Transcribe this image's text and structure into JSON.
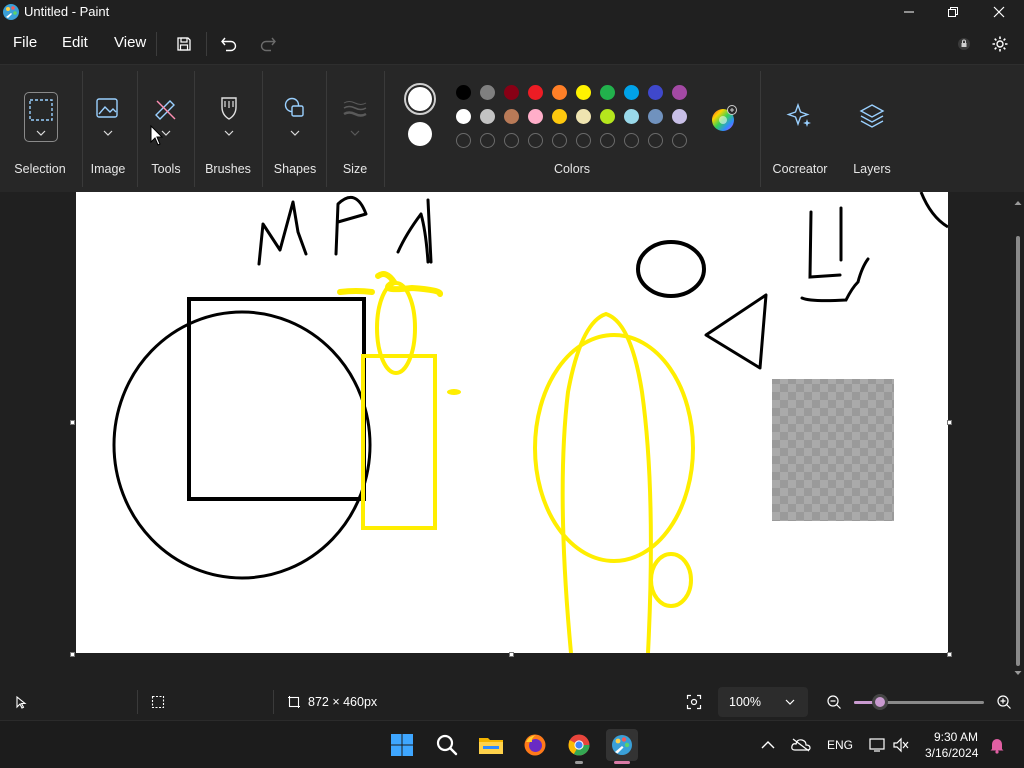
{
  "window": {
    "title": "Untitled - Paint"
  },
  "menu": {
    "file": "File",
    "edit": "Edit",
    "view": "View"
  },
  "ribbon": {
    "groups": {
      "selection": "Selection",
      "image": "Image",
      "tools": "Tools",
      "brushes": "Brushes",
      "shapes": "Shapes",
      "size": "Size",
      "colors": "Colors",
      "cocreator": "Cocreator",
      "layers": "Layers"
    },
    "primary_color": "#ffffff",
    "secondary_color": "#ffffff",
    "palette": [
      [
        "#000000",
        "#7f7f7f",
        "#880015",
        "#ed1c24",
        "#ff7f27",
        "#fff200",
        "#22b14c",
        "#00a2e8",
        "#3f48cc",
        "#a349a4"
      ],
      [
        "#ffffff",
        "#c3c3c3",
        "#b97a57",
        "#ffaec9",
        "#ffc90e",
        "#efe4b0",
        "#b5e61d",
        "#99d9ea",
        "#7092be",
        "#c8bfe7"
      ],
      [
        "",
        "",
        "",
        "",
        "",
        "",
        "",
        "",
        "",
        ""
      ]
    ]
  },
  "status": {
    "canvas_size": "872 × 460px",
    "zoom": "100%",
    "zoom_fraction": 0.15
  },
  "taskbar": {
    "language": "ENG",
    "time": "9:30 AM",
    "date": "3/16/2024"
  },
  "colors": {
    "app_bg": "#202020",
    "ribbon_bg": "#272727",
    "canvas_bg": "#ffffff",
    "accent_zoom": "#c99ad0",
    "yellow_stroke": "#ffee00"
  },
  "icons": {
    "app": "paint-icon",
    "save": "save-icon",
    "undo": "undo-icon",
    "redo": "redo-icon",
    "account": "account-icon",
    "settings": "gear-icon"
  }
}
